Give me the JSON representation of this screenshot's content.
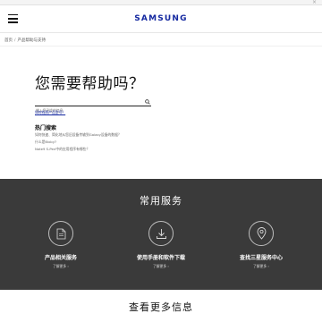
{
  "window": {
    "close_glyph": "×"
  },
  "header": {
    "menu_icon": "hamburger-menu-icon",
    "logo_text": "SAMSUNG",
    "logo_color": "#1428a0"
  },
  "breadcrumb": {
    "home": "首页",
    "separator": "/",
    "current": "产品帮助与支持"
  },
  "help": {
    "title": "您需要帮助吗？",
    "search_placeholder": "输入您寻找的信息",
    "search_icon": "search-icon",
    "find_model_link": "如何找到产品型号？"
  },
  "hot_search": {
    "title": "热门搜索",
    "items": [
      "如何快速、简化地从您旧设备传输到Galaxy设备的数据？",
      "什么是Bixby?",
      "Note9 S-Pen中的应用程序有哪些？"
    ]
  },
  "services": {
    "background": "#3a3a3a",
    "title": "常用服务",
    "items": [
      {
        "label": "产品相关服务",
        "link": "了解更多 ›",
        "icon": "document-icon"
      },
      {
        "label": "使用手册和软件下载",
        "link": "了解更多 ›",
        "icon": "download-icon"
      },
      {
        "label": "查找三星服务中心",
        "link": "了解更多 ›",
        "icon": "location-pin-icon"
      }
    ]
  },
  "more_info": {
    "title": "查看更多信息"
  }
}
